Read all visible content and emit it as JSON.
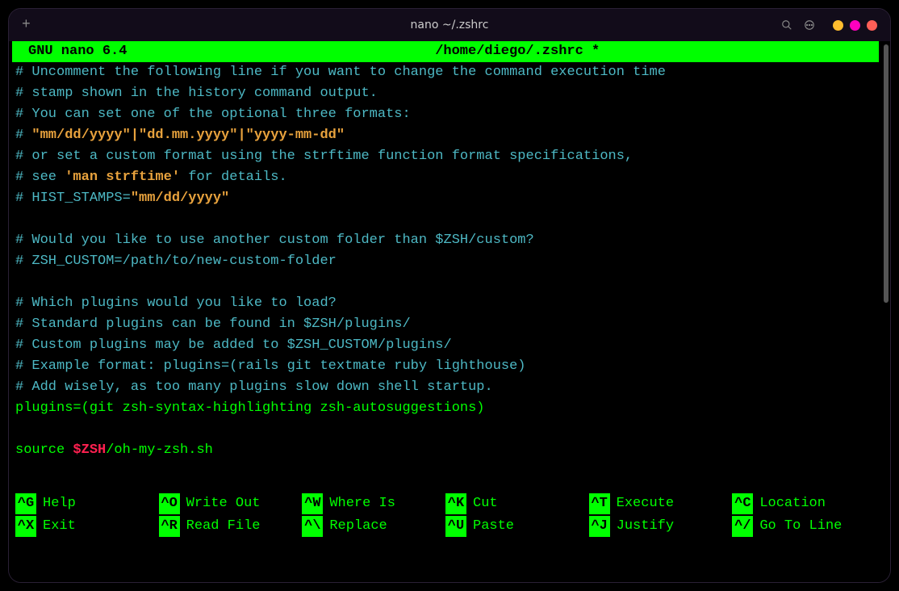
{
  "window": {
    "title": "nano ~/.zshrc"
  },
  "header": {
    "app": "GNU nano 6.4",
    "file": "/home/diego/.zshrc *"
  },
  "lines": {
    "l1": "# Uncomment the following line if you want to change the command execution time",
    "l2": "# stamp shown in the history command output.",
    "l3": "# You can set one of the optional three formats:",
    "l4a": "# ",
    "l4b": "\"mm/dd/yyyy\"|\"dd.mm.yyyy\"|\"yyyy-mm-dd\"",
    "l5": "# or set a custom format using the strftime function format specifications,",
    "l6a": "# see ",
    "l6b": "'man strftime'",
    "l6c": " for details.",
    "l7a": "# HIST_STAMPS=",
    "l7b": "\"mm/dd/yyyy\"",
    "l8": "# Would you like to use another custom folder than $ZSH/custom?",
    "l9": "# ZSH_CUSTOM=/path/to/new-custom-folder",
    "l10": "# Which plugins would you like to load?",
    "l11": "# Standard plugins can be found in $ZSH/plugins/",
    "l12": "# Custom plugins may be added to $ZSH_CUSTOM/plugins/",
    "l13": "# Example format: plugins=(rails git textmate ruby lighthouse)",
    "l14": "# Add wisely, as too many plugins slow down shell startup.",
    "l15": "plugins=(git zsh-syntax-highlighting zsh-autosuggestions)",
    "l16a": "source ",
    "l16b": "$ZSH",
    "l16c": "/oh-my-zsh.sh"
  },
  "shortcuts": {
    "row1": [
      {
        "key": "^G",
        "label": "Help"
      },
      {
        "key": "^O",
        "label": "Write Out"
      },
      {
        "key": "^W",
        "label": "Where Is"
      },
      {
        "key": "^K",
        "label": "Cut"
      },
      {
        "key": "^T",
        "label": "Execute"
      },
      {
        "key": "^C",
        "label": "Location"
      }
    ],
    "row2": [
      {
        "key": "^X",
        "label": "Exit"
      },
      {
        "key": "^R",
        "label": "Read File"
      },
      {
        "key": "^\\",
        "label": "Replace"
      },
      {
        "key": "^U",
        "label": "Paste"
      },
      {
        "key": "^J",
        "label": "Justify"
      },
      {
        "key": "^/",
        "label": "Go To Line"
      }
    ]
  }
}
